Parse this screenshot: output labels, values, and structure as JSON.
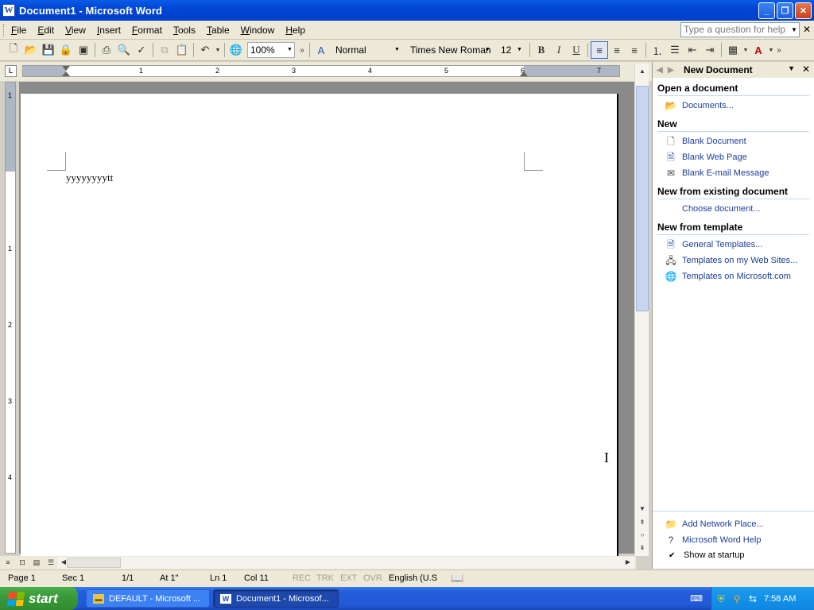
{
  "window": {
    "title": "Document1 - Microsoft Word"
  },
  "menu": {
    "items": [
      "File",
      "Edit",
      "View",
      "Insert",
      "Format",
      "Tools",
      "Table",
      "Window",
      "Help"
    ],
    "help_placeholder": "Type a question for help"
  },
  "toolbar": {
    "zoom": "100%",
    "style": "Normal",
    "font": "Times New Roman",
    "size": "12",
    "bold_label": "B",
    "italic_label": "I",
    "underline_label": "U"
  },
  "ruler": {
    "numbers": [
      "1",
      "2",
      "3",
      "4",
      "5",
      "6",
      "7"
    ]
  },
  "vruler": {
    "numbers": [
      "1",
      "1",
      "2",
      "3",
      "4"
    ]
  },
  "document": {
    "text": "yyyyyyyytt"
  },
  "taskpane": {
    "title": "New Document",
    "sections": [
      {
        "heading": "Open a document",
        "items": [
          "Documents..."
        ]
      },
      {
        "heading": "New",
        "items": [
          "Blank Document",
          "Blank Web Page",
          "Blank E-mail Message"
        ]
      },
      {
        "heading": "New from existing document",
        "items": [
          "Choose document..."
        ]
      },
      {
        "heading": "New from template",
        "items": [
          "General Templates...",
          "Templates on my Web Sites...",
          "Templates on Microsoft.com"
        ]
      }
    ],
    "bottom_links": [
      "Add Network Place...",
      "Microsoft Word Help"
    ],
    "show_at_startup": "Show at startup"
  },
  "status": {
    "page": "Page 1",
    "sec": "Sec 1",
    "pages": "1/1",
    "at": "At 1\"",
    "ln": "Ln 1",
    "col": "Col 11",
    "rec": "REC",
    "trk": "TRK",
    "ext": "EXT",
    "ovr": "OVR",
    "language": "English (U.S"
  },
  "taskbar": {
    "start": "start",
    "tasks": [
      "DEFAULT - Microsoft ...",
      "Document1 - Microsof..."
    ],
    "clock": "7:58 AM"
  }
}
